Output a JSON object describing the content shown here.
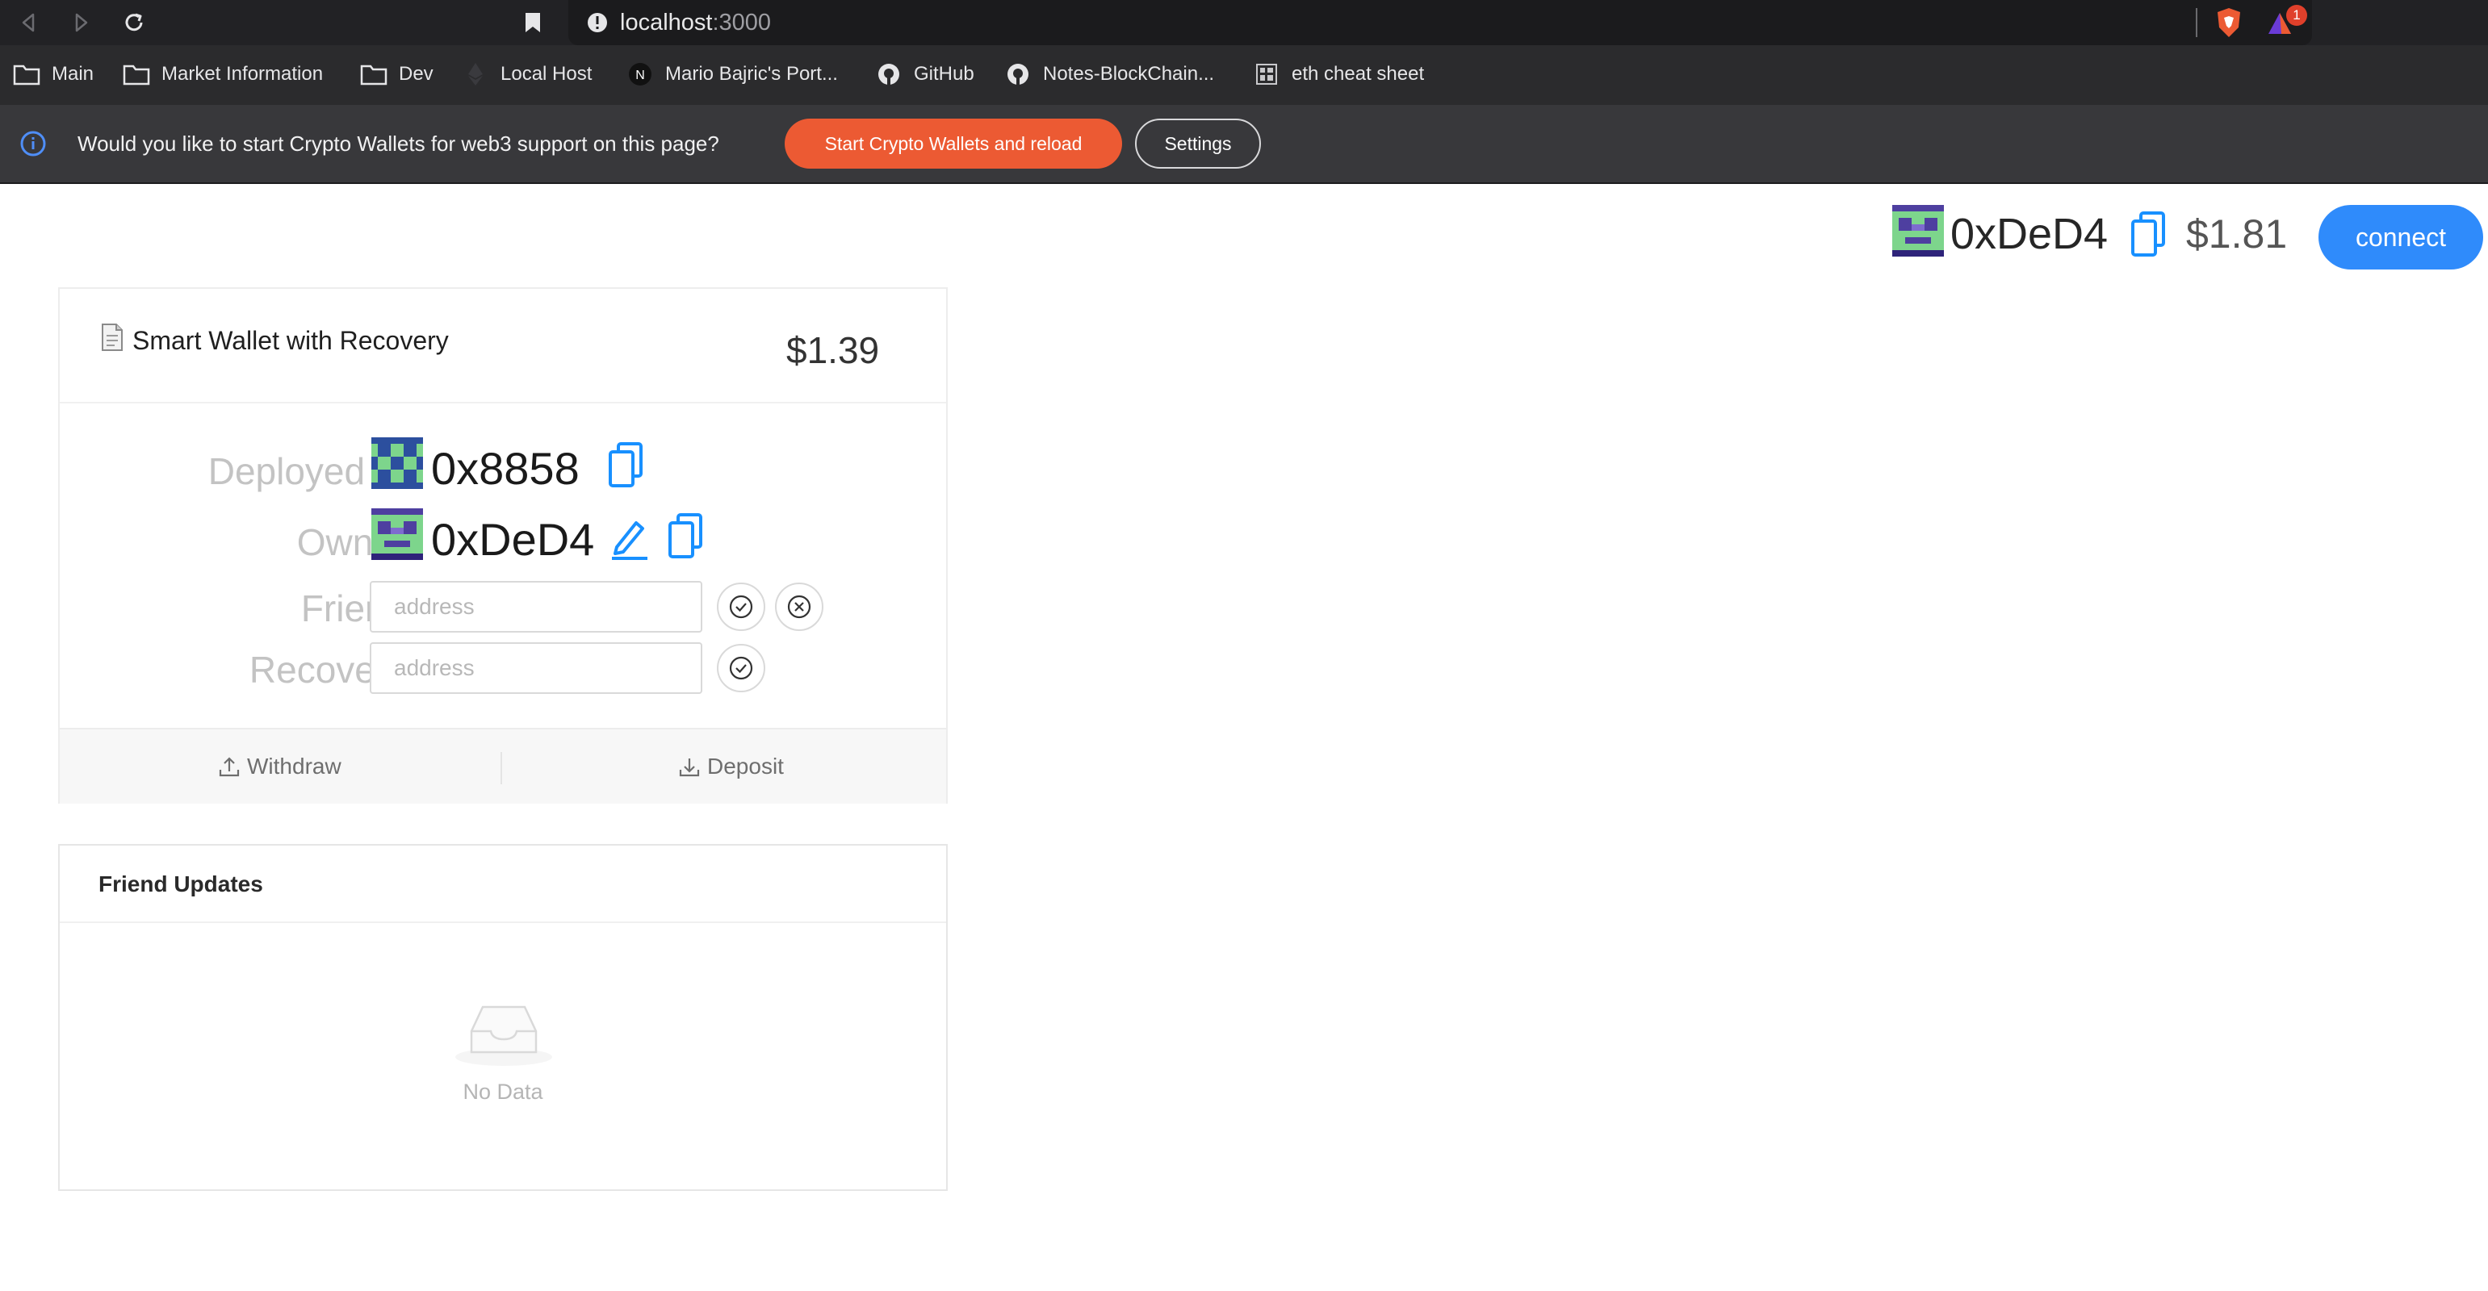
{
  "browser": {
    "url_host": "localhost",
    "url_port": ":3000",
    "notification_count": "1",
    "bookmarks": [
      {
        "label": "Main",
        "icon": "folder-icon"
      },
      {
        "label": "Market Information",
        "icon": "folder-icon"
      },
      {
        "label": "Dev",
        "icon": "folder-icon"
      },
      {
        "label": "Local Host",
        "icon": "ethereum-icon"
      },
      {
        "label": "Mario Bajric's Port...",
        "icon": "notion-icon"
      },
      {
        "label": "GitHub",
        "icon": "github-icon"
      },
      {
        "label": "Notes-BlockChain...",
        "icon": "github-icon"
      },
      {
        "label": "eth cheat sheet",
        "icon": "sheet-icon"
      }
    ],
    "infobar": {
      "message": "Would you like to start Crypto Wallets for web3 support on this page?",
      "primary_button": "Start Crypto Wallets and reload",
      "secondary_button": "Settings"
    }
  },
  "account": {
    "address": "0xDeD4",
    "balance": "$1.81",
    "connect_label": "connect"
  },
  "wallet": {
    "title": "Smart Wallet with Recovery",
    "balance": "$1.39",
    "deployed_label": "Deployed to:",
    "deployed_address": "0x8858",
    "owner_label": "Owner:",
    "owner_address": "0xDeD4",
    "friend_label": "Friend:",
    "friend_placeholder": "address",
    "recovery_label": "Recovery:",
    "recovery_placeholder": "address",
    "withdraw_label": "Withdraw",
    "deposit_label": "Deposit"
  },
  "friend_updates": {
    "title": "Friend Updates",
    "empty_text": "No Data"
  },
  "colors": {
    "brave_orange": "#ec5a33",
    "connect_blue": "#2f8bfb",
    "copy_blue": "#1890ff"
  }
}
